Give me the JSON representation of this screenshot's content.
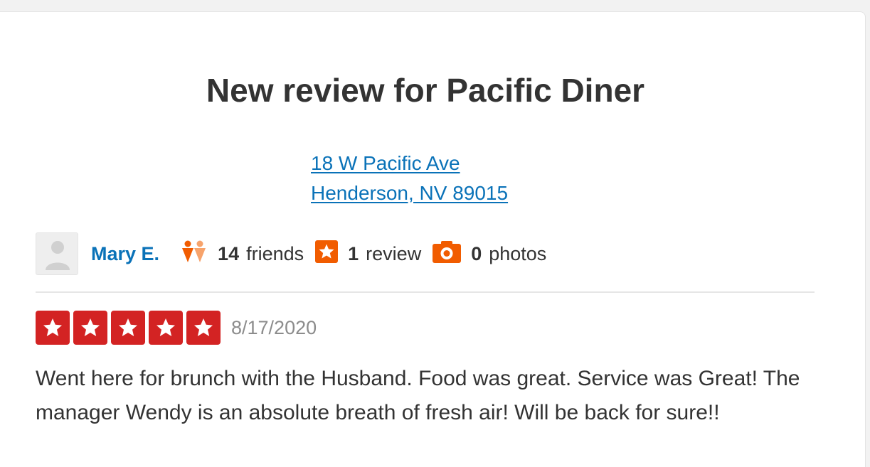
{
  "header": {
    "title": "New review for Pacific Diner"
  },
  "business": {
    "address_line1": "18 W Pacific Ave",
    "address_line2": "Henderson, NV 89015"
  },
  "reviewer": {
    "name": "Mary E.",
    "friends_count": "14",
    "friends_label": "friends",
    "reviews_count": "1",
    "reviews_label": "review",
    "photos_count": "0",
    "photos_label": "photos"
  },
  "review": {
    "rating": 5,
    "max_rating": 5,
    "date": "8/17/2020",
    "text": "Went here for brunch with the Husband. Food was great. Service was Great! The manager Wendy is an absolute breath of fresh air! Will be back for sure!!"
  },
  "icons": {
    "friends": "friends-icon",
    "review": "star-icon",
    "photos": "camera-icon",
    "avatar": "user-silhouette-icon"
  },
  "colors": {
    "link": "#0a72b8",
    "star_fill": "#d32323",
    "stat_icon": "#f15c00",
    "muted": "#8c8c8c",
    "text": "#333333"
  }
}
